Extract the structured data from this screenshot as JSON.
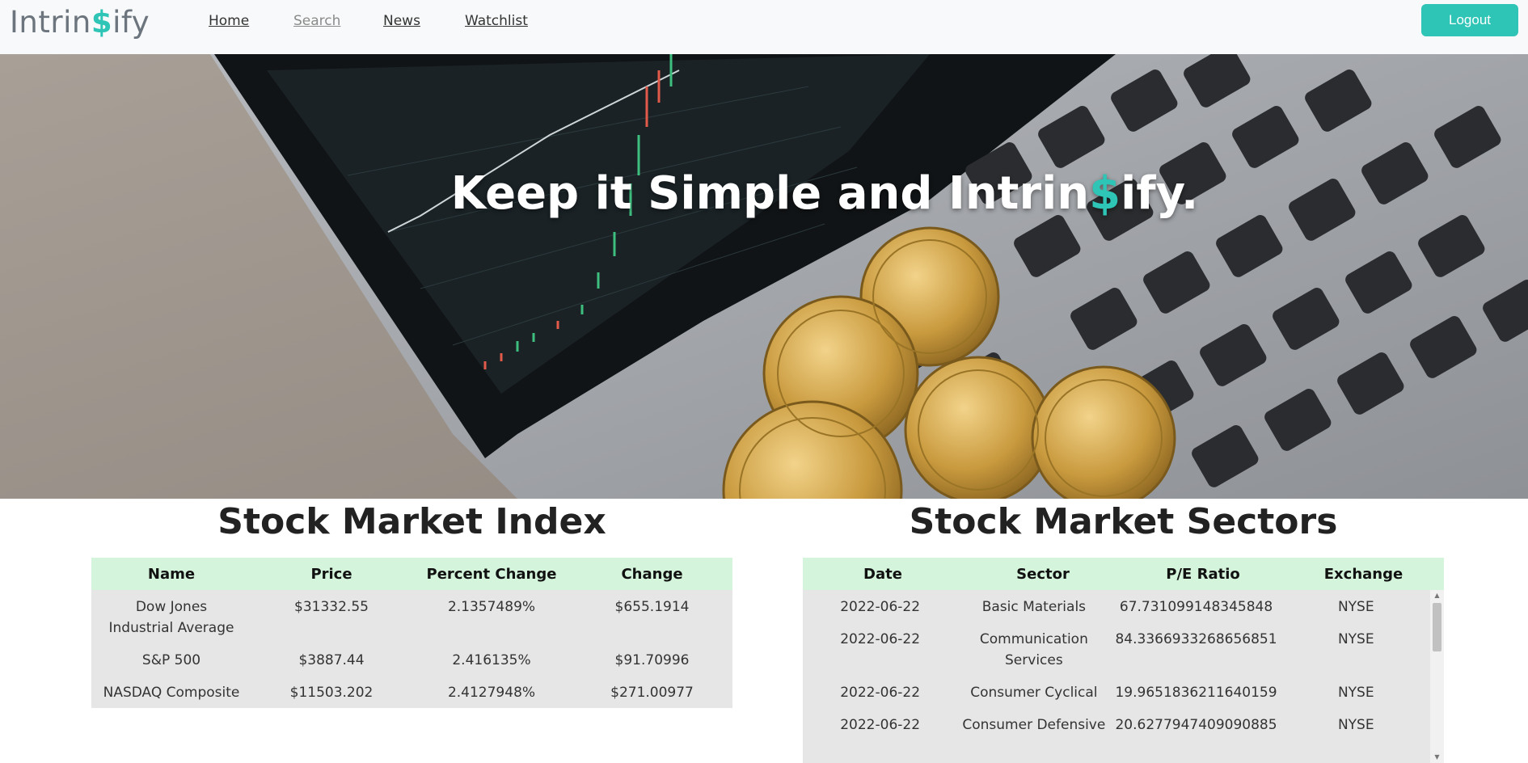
{
  "brand": {
    "prefix": "Intrin",
    "dollar": "$",
    "suffix": "ify"
  },
  "nav": {
    "home": "Home",
    "search": "Search",
    "news": "News",
    "watchlist": "Watchlist",
    "logout": "Logout"
  },
  "hero": {
    "title_prefix": "Keep it Simple and Intrin",
    "title_dollar": "$",
    "title_suffix": "ify."
  },
  "index": {
    "title": "Stock Market Index",
    "headers": [
      "Name",
      "Price",
      "Percent Change",
      "Change"
    ],
    "rows": [
      [
        "Dow Jones Industrial Average",
        "$31332.55",
        "2.1357489%",
        "$655.1914"
      ],
      [
        "S&P 500",
        "$3887.44",
        "2.416135%",
        "$91.70996"
      ],
      [
        "NASDAQ Composite",
        "$11503.202",
        "2.4127948%",
        "$271.00977"
      ]
    ]
  },
  "sectors": {
    "title": "Stock Market Sectors",
    "headers": [
      "Date",
      "Sector",
      "P/E Ratio",
      "Exchange"
    ],
    "rows": [
      [
        "2022-06-22",
        "Basic Materials",
        "67.731099148345848",
        "NYSE"
      ],
      [
        "2022-06-22",
        "Communication Services",
        "84.3366933268656851",
        "NYSE"
      ],
      [
        "2022-06-22",
        "Consumer Cyclical",
        "19.9651836211640159",
        "NYSE"
      ],
      [
        "2022-06-22",
        "Consumer Defensive",
        "20.6277947409090885",
        "NYSE"
      ]
    ]
  },
  "colors": {
    "accent": "#2ec4b6",
    "table_header": "#d4f5dc",
    "table_body": "#e6e6e6",
    "navbar": "#f8f9fa"
  },
  "icons": {
    "scroll_up": "▲",
    "scroll_down": "▼"
  }
}
